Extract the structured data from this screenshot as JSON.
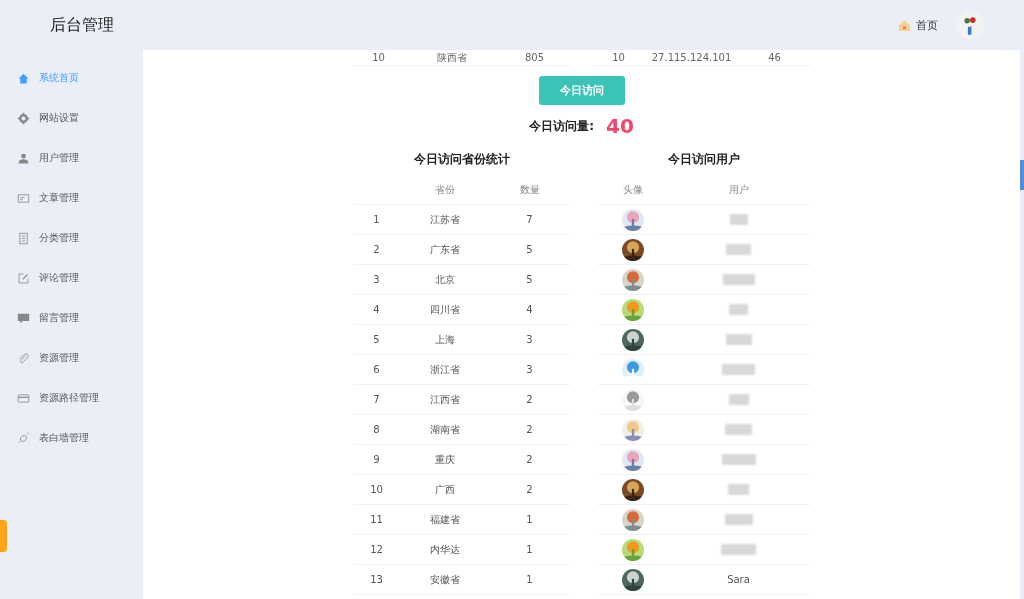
{
  "header": {
    "title": "后台管理",
    "home_link": "首页"
  },
  "sidebar": {
    "items": [
      {
        "label": "系统首页",
        "selected": true
      },
      {
        "label": "网站设置",
        "selected": false
      },
      {
        "label": "用户管理",
        "selected": false
      },
      {
        "label": "文章管理",
        "selected": false
      },
      {
        "label": "分类管理",
        "selected": false
      },
      {
        "label": "评论管理",
        "selected": false
      },
      {
        "label": "留言管理",
        "selected": false
      },
      {
        "label": "资源管理",
        "selected": false
      },
      {
        "label": "资源路径管理",
        "selected": false
      },
      {
        "label": "表白墙管理",
        "selected": false
      }
    ]
  },
  "previous_tables": {
    "left_row": [
      "10",
      "陕西省",
      "805"
    ],
    "right_row": [
      "10",
      "27.115.124.101",
      "46"
    ]
  },
  "today_button": "今日访问",
  "today_count": {
    "label": "今日访问量:",
    "value": "40"
  },
  "province_table": {
    "title": "今日访问省份统计",
    "columns": [
      "",
      "省份",
      "数量"
    ],
    "rows": [
      [
        "1",
        "江苏省",
        "7"
      ],
      [
        "2",
        "广东省",
        "5"
      ],
      [
        "3",
        "北京",
        "5"
      ],
      [
        "4",
        "四川省",
        "4"
      ],
      [
        "5",
        "上海",
        "3"
      ],
      [
        "6",
        "浙江省",
        "3"
      ],
      [
        "7",
        "江西省",
        "2"
      ],
      [
        "8",
        "湖南省",
        "2"
      ],
      [
        "9",
        "重庆",
        "2"
      ],
      [
        "10",
        "广西",
        "2"
      ],
      [
        "11",
        "福建省",
        "1"
      ],
      [
        "12",
        "内华达",
        "1"
      ],
      [
        "13",
        "安徽省",
        "1"
      ]
    ]
  },
  "user_table": {
    "title": "今日访问用户",
    "columns": [
      "头像",
      "用户"
    ],
    "rows": [
      {
        "user": {
          "blurred": true
        }
      },
      {
        "user": {
          "blurred": true
        }
      },
      {
        "user": {
          "blurred": true
        }
      },
      {
        "user": {
          "blurred": true
        }
      },
      {
        "user": {
          "blurred": true
        }
      },
      {
        "user": {
          "blurred": true
        }
      },
      {
        "user": {
          "blurred": true
        }
      },
      {
        "user": {
          "blurred": true
        }
      },
      {
        "user": {
          "blurred": true
        }
      },
      {
        "user": {
          "blurred": true
        }
      },
      {
        "user": {
          "blurred": true
        }
      },
      {
        "user": {
          "blurred": true
        }
      },
      {
        "user": {
          "blurred": false,
          "name": "Sara"
        }
      }
    ]
  }
}
